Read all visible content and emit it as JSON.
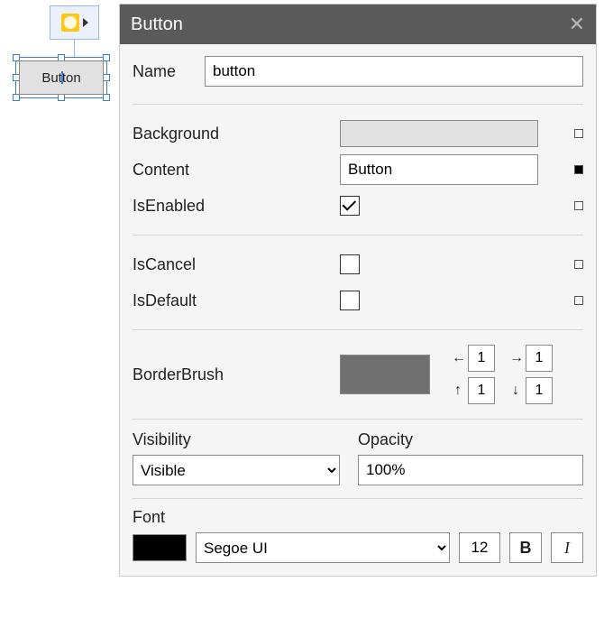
{
  "designer": {
    "button_content": "Button"
  },
  "panel": {
    "title": "Button",
    "name_label": "Name",
    "name_value": "button",
    "background_label": "Background",
    "background_color": "#e1e1e1",
    "content_label": "Content",
    "content_value": "Button",
    "isenabled_label": "IsEnabled",
    "isenabled_checked": true,
    "iscancel_label": "IsCancel",
    "iscancel_checked": false,
    "isdefault_label": "IsDefault",
    "isdefault_checked": false,
    "borderbrush_label": "BorderBrush",
    "borderbrush_color": "#707070",
    "thickness": {
      "left": "1",
      "right": "1",
      "top": "1",
      "bottom": "1"
    },
    "visibility_label": "Visibility",
    "visibility_value": "Visible",
    "opacity_label": "Opacity",
    "opacity_value": "100%",
    "font_label": "Font",
    "font_color": "#000000",
    "font_family": "Segoe UI",
    "font_size": "12",
    "bold_label": "B",
    "italic_label": "I"
  }
}
